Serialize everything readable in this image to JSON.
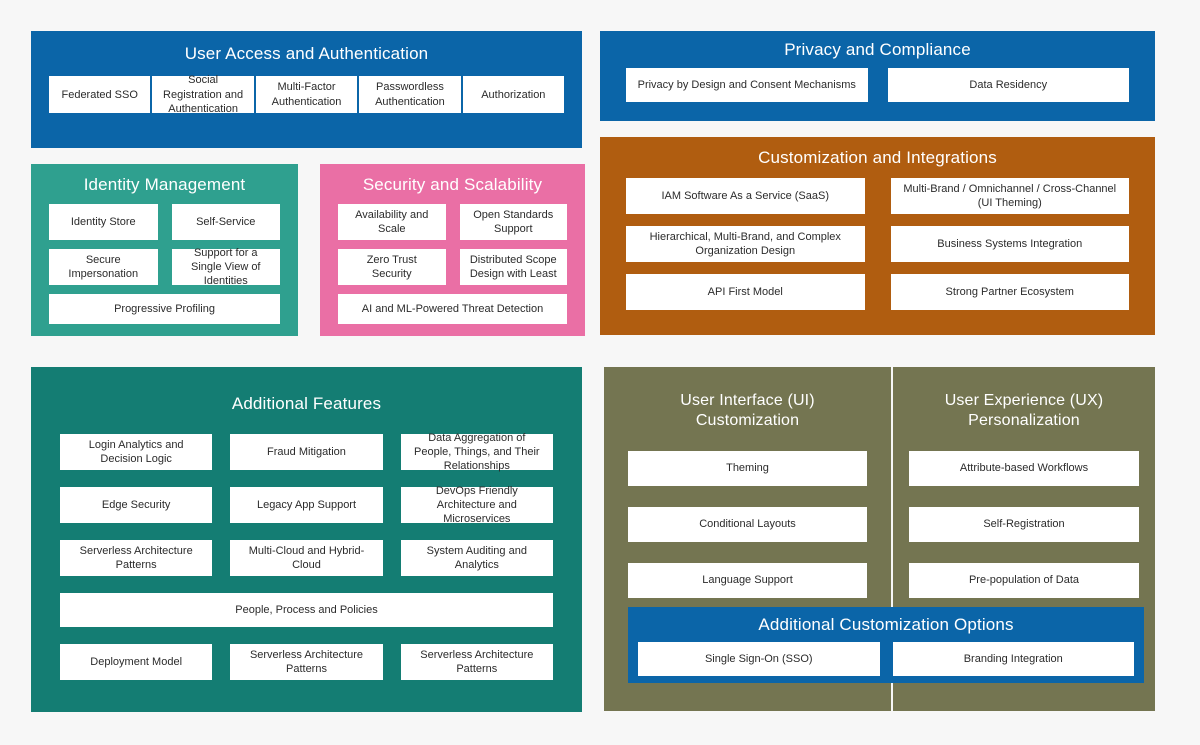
{
  "colors": {
    "background": "#f7f7f7",
    "blue": "#0b65a8",
    "teal_light": "#2fa08f",
    "teal_dark": "#147d73",
    "pink": "#ea6fa5",
    "orange": "#b05d10",
    "olive": "#747551",
    "tile_bg": "#ffffff",
    "tile_text": "#2b2b2b",
    "title_text": "#ffffff"
  },
  "panels": {
    "user_access": {
      "title": "User Access and Authentication",
      "items": [
        "Federated SSO",
        "Social Registration and Authentication",
        "Multi-Factor Authentication",
        "Passwordless Authentication",
        "Authorization"
      ]
    },
    "identity_management": {
      "title": "Identity Management",
      "rows": [
        [
          "Identity Store",
          "Self-Service"
        ],
        [
          "Secure Impersonation",
          "Support for a Single View of Identities"
        ],
        [
          "Progressive Profiling"
        ]
      ]
    },
    "security_scalability": {
      "title": "Security and Scalability",
      "rows": [
        [
          "Availability and Scale",
          "Open Standards Support"
        ],
        [
          "Zero Trust Security",
          "Distributed Scope Design with Least"
        ],
        [
          "AI and ML-Powered Threat Detection"
        ]
      ]
    },
    "additional_features": {
      "title": "Additional Features",
      "rows": [
        [
          "Login Analytics and Decision Logic",
          "Fraud Mitigation",
          "Data Aggregation of People, Things, and Their Relationships"
        ],
        [
          "Edge Security",
          "Legacy App Support",
          "DevOps Friendly Architecture and Microservices"
        ],
        [
          "Serverless Architecture Patterns",
          "Multi-Cloud and Hybrid-Cloud",
          "System Auditing and Analytics"
        ],
        [
          "People, Process and Policies"
        ],
        [
          "Deployment Model",
          "Serverless Architecture Patterns",
          "Serverless Architecture Patterns"
        ]
      ]
    },
    "privacy_compliance": {
      "title": "Privacy and Compliance",
      "items": [
        "Privacy by Design and Consent Mechanisms",
        "Data Residency"
      ]
    },
    "customization_integrations": {
      "title": "Customization and Integrations",
      "rows": [
        [
          "IAM Software As a Service (SaaS)",
          "Multi-Brand / Omnichannel / Cross-Channel (UI Theming)"
        ],
        [
          "Hierarchical, Multi-Brand, and Complex Organization Design",
          "Business Systems Integration"
        ],
        [
          "API First Model",
          "Strong Partner Ecosystem"
        ]
      ]
    },
    "ui_customization": {
      "title": "User Interface (UI) Customization",
      "items": [
        "Theming",
        "Conditional Layouts",
        "Language Support"
      ]
    },
    "ux_personalization": {
      "title": "User Experience (UX) Personalization",
      "items": [
        "Attribute-based Workflows",
        "Self-Registration",
        "Pre-population of Data"
      ]
    },
    "additional_customization": {
      "title": "Additional Customization Options",
      "items": [
        "Single Sign-On (SSO)",
        "Branding Integration"
      ]
    }
  }
}
